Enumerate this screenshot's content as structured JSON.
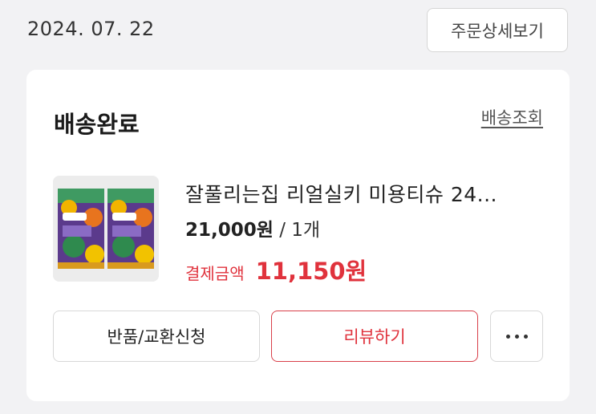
{
  "order": {
    "date": "2024. 07. 22",
    "detail_button": "주문상세보기"
  },
  "card": {
    "status": "배송완료",
    "tracking_link": "배송조회",
    "product": {
      "name": "잘풀리는집 리얼실키 미용티슈 24...",
      "price": "21,000원",
      "separator": " / ",
      "quantity": "1개",
      "payment_label": "결제금액",
      "payment_amount": "11,150원"
    },
    "actions": {
      "return_exchange": "반품/교환신청",
      "review": "리뷰하기",
      "more_icon": "more-horizontal-icon"
    }
  },
  "colors": {
    "accent": "#e0323c",
    "background": "#f2f2f4",
    "card": "#ffffff"
  }
}
